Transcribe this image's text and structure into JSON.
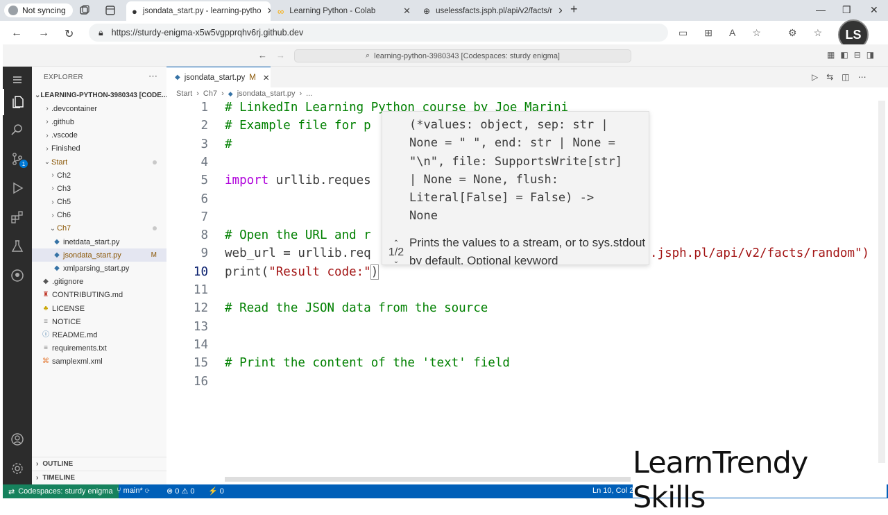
{
  "browser": {
    "profile_label": "Not syncing",
    "tabs": [
      {
        "label": "jsondata_start.py - learning-pytho"
      },
      {
        "label": "Learning Python - Colab"
      },
      {
        "label": "uselessfacts.jsph.pl/api/v2/facts/r"
      }
    ],
    "url": "https://sturdy-enigma-x5w5vgpprqhv6rj.github.dev"
  },
  "vscode": {
    "command_center": "learning-python-3980343 [Codespaces: sturdy enigma]",
    "explorer_title": "EXPLORER",
    "project": "LEARNING-PYTHON-3980343 [CODE...",
    "tree": [
      {
        "label": ".devcontainer"
      },
      {
        "label": ".github"
      },
      {
        "label": ".vscode"
      },
      {
        "label": "Finished"
      },
      {
        "label": "Start"
      },
      {
        "label": "Ch2"
      },
      {
        "label": "Ch3"
      },
      {
        "label": "Ch5"
      },
      {
        "label": "Ch6"
      },
      {
        "label": "Ch7"
      },
      {
        "label": "inetdata_start.py"
      },
      {
        "label": "jsondata_start.py",
        "mark": "M"
      },
      {
        "label": "xmlparsing_start.py"
      },
      {
        "label": ".gitignore"
      },
      {
        "label": "CONTRIBUTING.md"
      },
      {
        "label": "LICENSE"
      },
      {
        "label": "NOTICE"
      },
      {
        "label": "README.md"
      },
      {
        "label": "requirements.txt"
      },
      {
        "label": "samplexml.xml"
      }
    ],
    "outline": "OUTLINE",
    "timeline": "TIMELINE",
    "editor_tab": {
      "label": "jsondata_start.py",
      "mark": "M"
    },
    "breadcrumb": [
      "Start",
      "Ch7",
      "jsondata_start.py",
      "..."
    ],
    "line_numbers": [
      "1",
      "2",
      "3",
      "4",
      "5",
      "6",
      "7",
      "8",
      "9",
      "10",
      "11",
      "12",
      "13",
      "14",
      "15",
      "16"
    ],
    "code": {
      "l1": "# LinkedIn Learning Python course by Joe Marini",
      "l2": "# Example file for p",
      "l3": "#",
      "l5a": "import",
      "l5b": " urllib.reques",
      "l8": "# Open the URL and r",
      "l9a": "web_url = urllib.req",
      "l9b": ".jsph.pl/api/v2/facts/random\")",
      "l10a": "print(",
      "l10b": "\"Result code:\"",
      "l10c": ")",
      "l12": "# Read the JSON data from the source",
      "l15": "# Print the content of the 'text' field"
    },
    "hover": {
      "signature": [
        "(*values: object, sep: str |",
        "None = \" \", end: str | None =",
        "\"\\n\", file: SupportsWrite[str]",
        "| None = None, flush:",
        "Literal[False] = False) ->",
        "None"
      ],
      "doc": "Prints the values to a stream, or to sys.stdout by default. Optional keyword",
      "pager": "1/2"
    },
    "status": {
      "remote": "Codespaces: sturdy enigma",
      "branch": "main*",
      "problems": "0",
      "warnings": "0",
      "ports": "0",
      "position": "Ln 10, Col 21"
    }
  },
  "watermark": "LearnTrendy Skills",
  "logo_text": "LS"
}
